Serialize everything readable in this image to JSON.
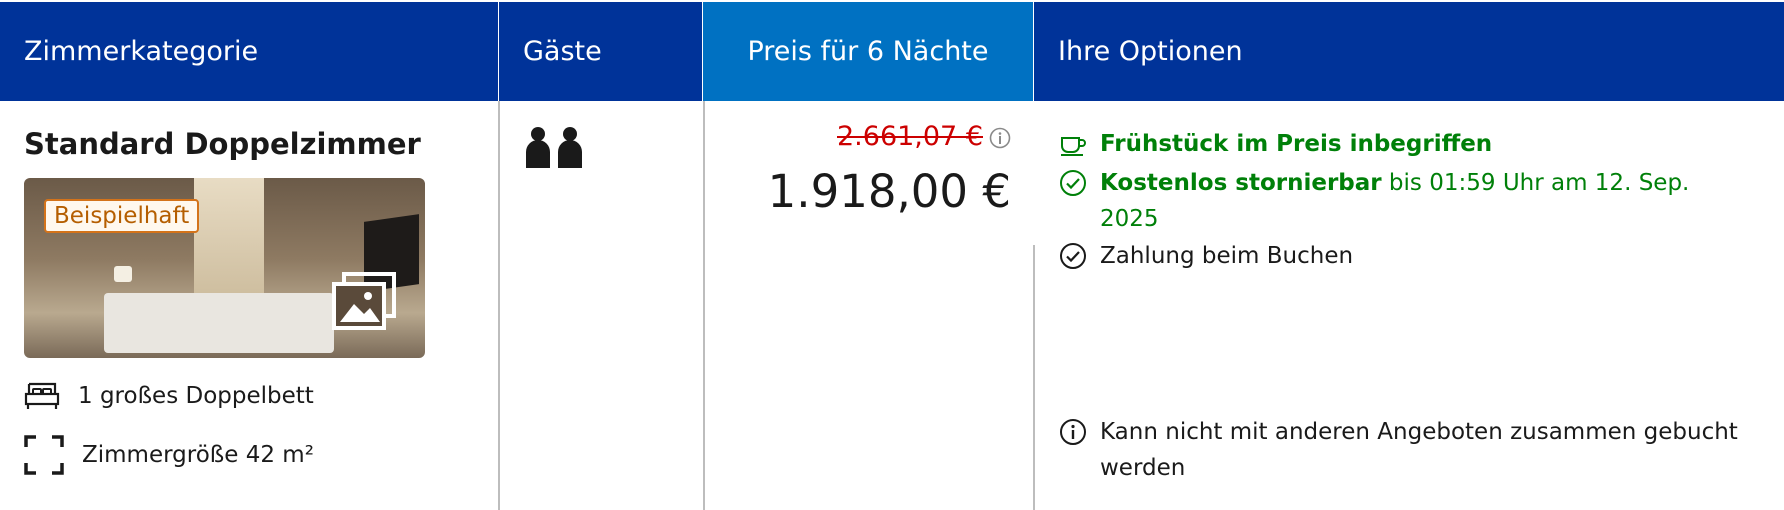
{
  "header": {
    "col_room": "Zimmerkategorie",
    "col_guests": "Gäste",
    "col_price": "Preis für 6 Nächte",
    "col_options": "Ihre Optionen"
  },
  "room": {
    "name": "Standard Doppelzimmer",
    "photo_badge": "Beispielhaft",
    "bed": "1 großes Doppelbett",
    "size": "Zimmergröße 42 m²"
  },
  "guests": {
    "count": 2,
    "icon": "person-icon"
  },
  "price": {
    "original": "2.661,07 €",
    "current": "1.918,00 €"
  },
  "options": {
    "breakfast": "Frühstück im Preis inbegriffen",
    "cancel_bold": "Kostenlos stornierbar",
    "cancel_rest": " bis 01:59 Uhr am 12. Sep. 2025",
    "payment": "Zahlung beim Buchen",
    "restriction": "Kann nicht mit anderen Angeboten zusammen gebucht werden"
  },
  "colors": {
    "header_bg": "#003399",
    "price_header_bg": "#0071c2",
    "green": "#008009",
    "strike_red": "#cc0000"
  }
}
